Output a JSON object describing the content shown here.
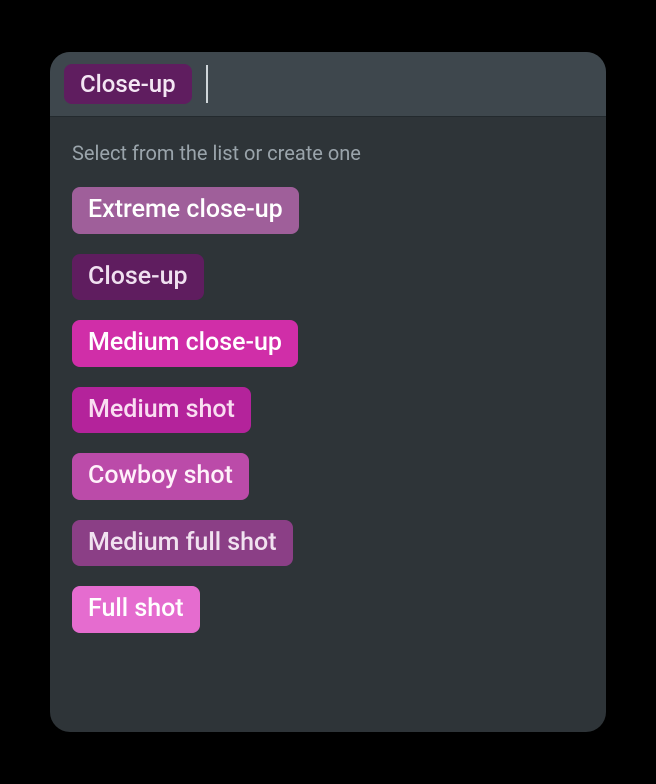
{
  "selected": {
    "label": "Close-up",
    "color": "#5f1d5f"
  },
  "hint": "Select from the list or create one",
  "options": [
    {
      "label": "Extreme close-up",
      "color": "#9f5f9a"
    },
    {
      "label": "Close-up",
      "color": "#5f1d5f"
    },
    {
      "label": "Medium close-up",
      "color": "#d02ea8"
    },
    {
      "label": "Medium shot",
      "color": "#b4239b"
    },
    {
      "label": "Cowboy shot",
      "color": "#bb4ba9"
    },
    {
      "label": "Medium full shot",
      "color": "#8b3f86"
    },
    {
      "label": "Full shot",
      "color": "#e56ccf"
    }
  ]
}
